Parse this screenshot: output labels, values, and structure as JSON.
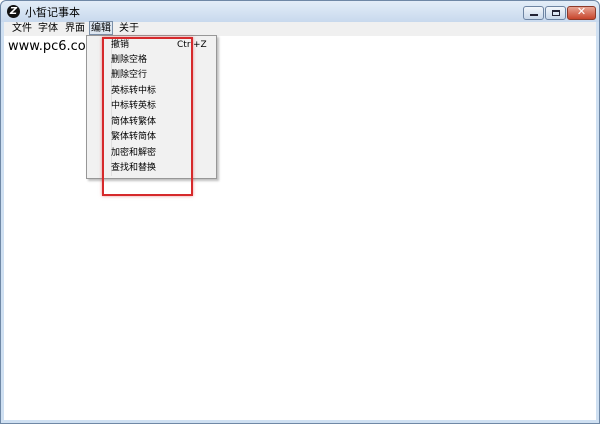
{
  "window": {
    "title": "小皙记事本",
    "icon": "app-logo-icon",
    "controls": [
      "minimize-icon",
      "maximize-icon",
      "close-icon"
    ]
  },
  "menubar": {
    "items": [
      "文件",
      "字体",
      "界面",
      "编辑",
      "关于"
    ],
    "active": "编辑"
  },
  "edit_menu": {
    "items": [
      {
        "label": "撤销",
        "shortcut": "Ctrl+Z"
      },
      {
        "label": "删除空格"
      },
      {
        "label": "删除空行"
      },
      {
        "label": "英标转中标"
      },
      {
        "label": "中标转英标"
      },
      {
        "label": "简体转繁体"
      },
      {
        "label": "繁体转简体"
      },
      {
        "label": "加密和解密"
      },
      {
        "label": "查找和替换"
      }
    ]
  },
  "editor": {
    "text": "www.pc6.com"
  },
  "colors": {
    "highlight_border": "#d6292b",
    "title_bar": "#c8d9ed",
    "menu_background": "#f1f1f1"
  }
}
